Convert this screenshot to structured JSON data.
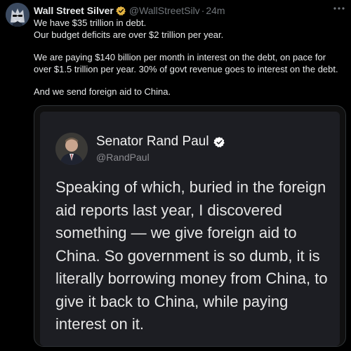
{
  "tweet": {
    "author_name": "Wall Street Silver",
    "handle": "@WallStreetSilv",
    "separator": "·",
    "time": "24m",
    "verified_color": "#e3b341",
    "lines": [
      "We have $35 trillion in debt.",
      "Our budget deficits are over $2 trillion per year.",
      "We are paying $140 billion per month in interest on the debt, on pace for over $1.5 trillion per year. 30% of govt revenue goes to interest on the debt.",
      "And we send foreign aid to China."
    ],
    "icons": {
      "avatar": "wolf-avatar-icon",
      "verified": "gold-verified-badge-icon",
      "more": "more-horizontal-icon"
    }
  },
  "quoted_image": {
    "author_name": "Senator Rand Paul",
    "handle": "@RandPaul",
    "verified_color": "#ffffff",
    "text": "Speaking of which, buried in the foreign aid reports last year, I discovered something — we give foreign aid to China. So government is so dumb, it is literally borrowing money from China, to give it back to China, while paying interest on it.",
    "icons": {
      "avatar": "profile-photo-icon",
      "verified": "white-verified-badge-icon"
    }
  }
}
